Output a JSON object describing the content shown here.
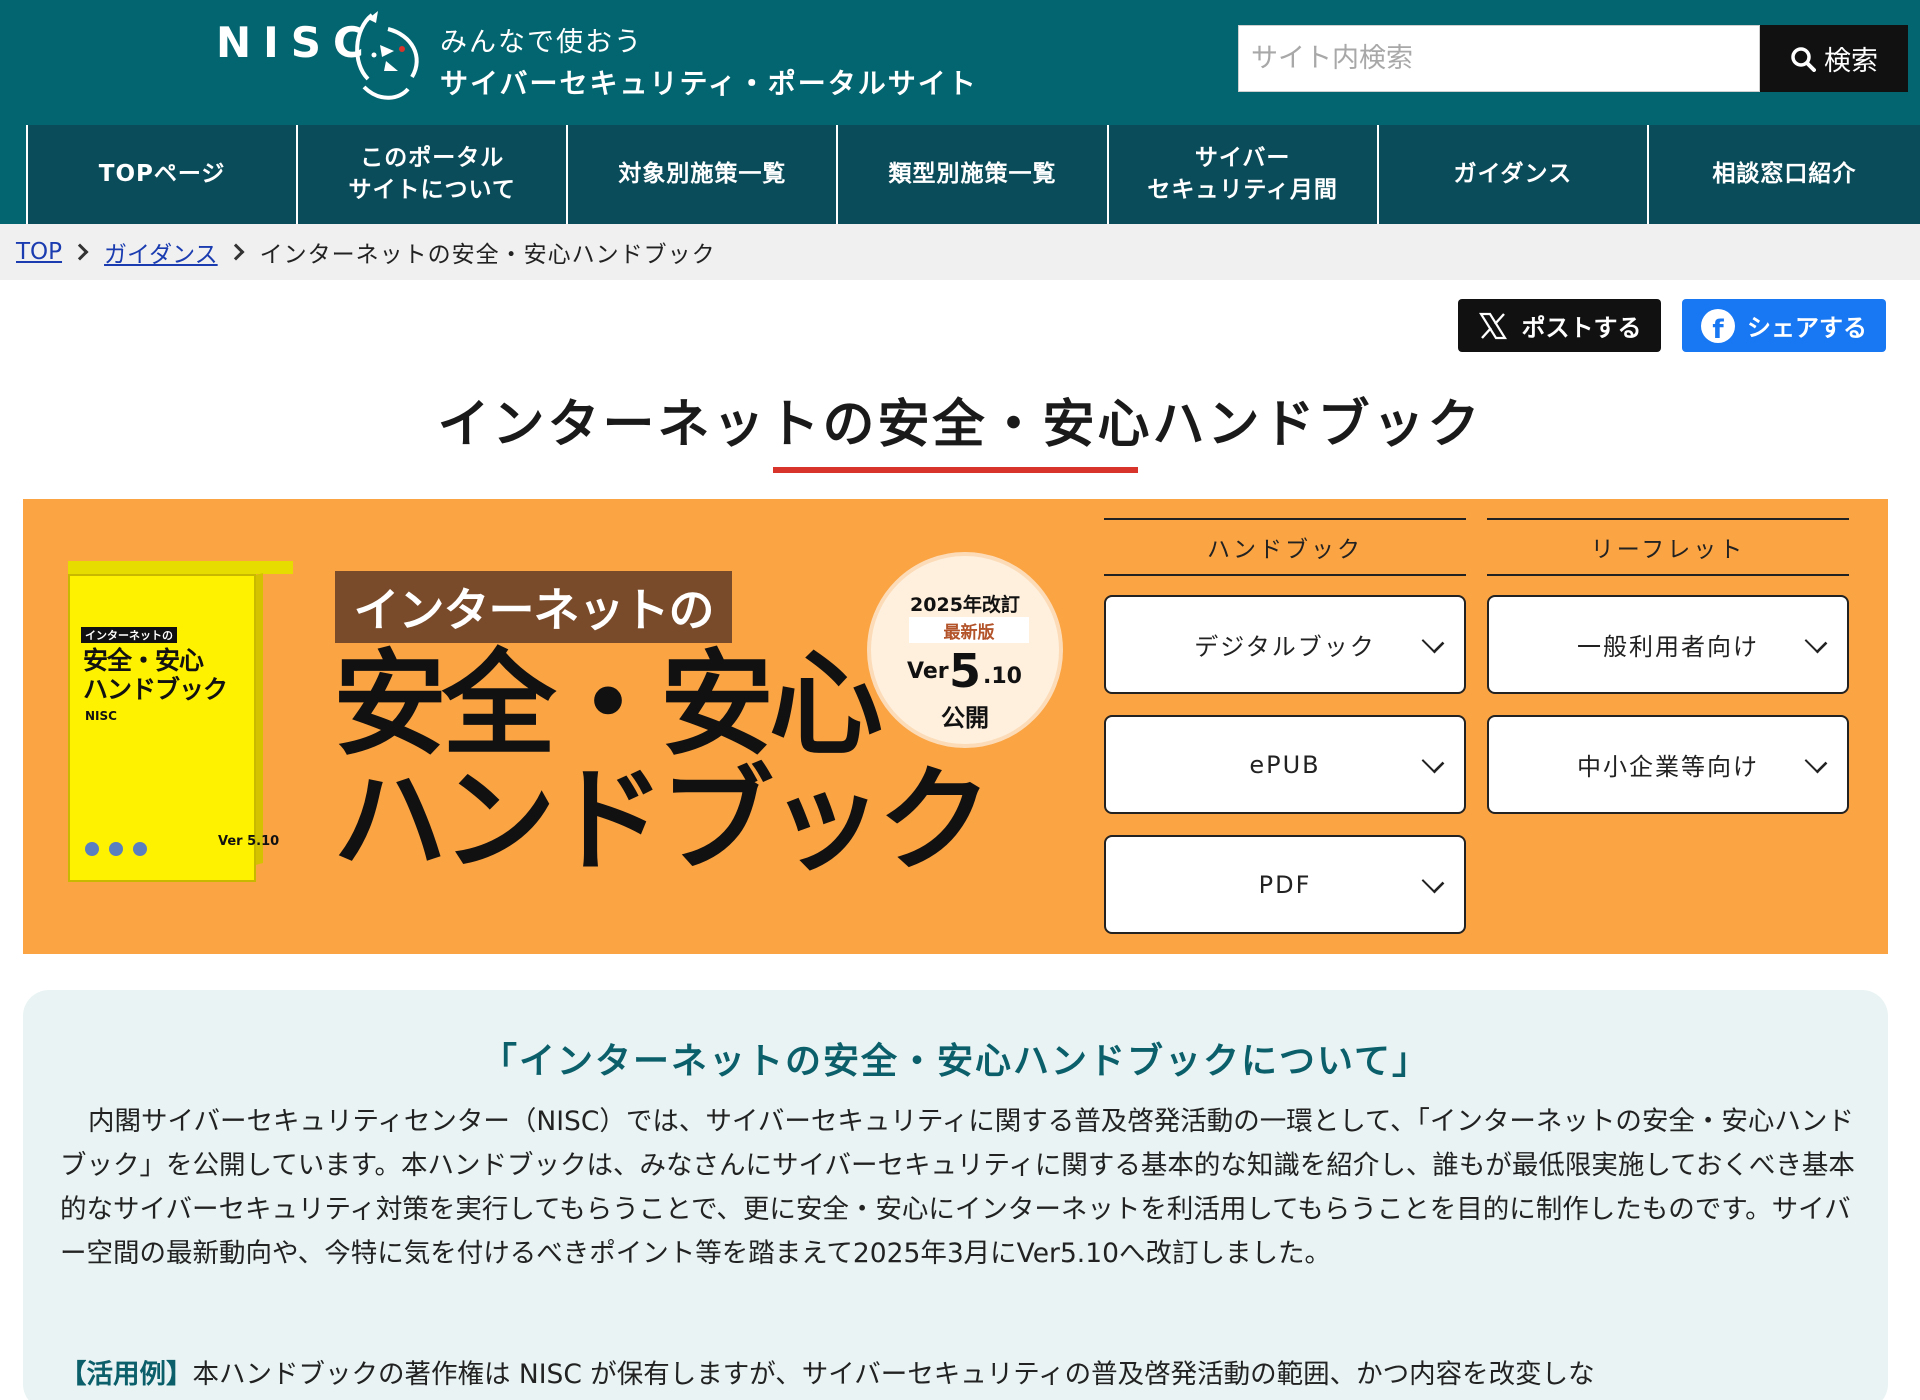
{
  "header": {
    "logo_text": "NISC",
    "tagline_top": "みんなで使おう",
    "tagline_main": "サイバーセキュリティ・ポータルサイト",
    "search_placeholder": "サイト内検索",
    "search_button": "検索",
    "bg_color": "#03656f"
  },
  "nav": {
    "items": [
      {
        "label": "TOPページ"
      },
      {
        "label": "このポータル\nサイトについて"
      },
      {
        "label": "対象別施策一覧"
      },
      {
        "label": "類型別施策一覧"
      },
      {
        "label": "サイバー\nセキュリティ月間"
      },
      {
        "label": "ガイダンス"
      },
      {
        "label": "相談窓口紹介"
      }
    ]
  },
  "breadcrumb": {
    "items": [
      "TOP",
      "ガイダンス"
    ],
    "current": "インターネットの安全・安心ハンドブック"
  },
  "share": {
    "x_label": "ポストする",
    "facebook_label": "シェアする"
  },
  "page_title": "インターネットの安全・安心ハンドブック",
  "banner": {
    "book_small_label": "インターネットの",
    "book_title": "安全・安心\nハンドブック",
    "book_brand": "NISC",
    "book_version": "Ver 5.10",
    "tag": "インターネットの",
    "headline": "安全・安心\nハンドブック",
    "badge_year": "2025年改訂",
    "badge_new": "最新版",
    "badge_ver_label": "Ver",
    "badge_ver": "5",
    "badge_minor": ".10",
    "badge_release": "公開",
    "bg_color": "#fba443",
    "columns": [
      {
        "title": "ハンドブック",
        "buttons": [
          "デジタルブック",
          "ePUB",
          "PDF"
        ]
      },
      {
        "title": "リーフレット",
        "buttons": [
          "一般利用者向け",
          "中小企業等向け"
        ]
      }
    ]
  },
  "info": {
    "heading": "「インターネットの安全・安心ハンドブックについて」",
    "body": "内閣サイバーセキュリティセンター（NISC）では、サイバーセキュリティに関する普及啓発活動の一環として、「インターネットの安全・安心ハンドブック」を公開しています。本ハンドブックは、みなさんにサイバーセキュリティに関する基本的な知識を紹介し、誰もが最低限実施しておくべき基本的なサイバーセキュリティ対策を実行してもらうことで、更に安全・安心にインターネットを利活用してもらうことを目的に制作したものです。サイバー空間の最新動向や、今特に気を付けるべきポイント等を踏まえて2025年3月にVer5.10へ改訂しました。",
    "usage_label": "【活用例】",
    "usage_text": "本ハンドブックの著作権は NISC が保有しますが、サイバーセキュリティの普及啓発活動の範囲、かつ内容を改変しな"
  }
}
